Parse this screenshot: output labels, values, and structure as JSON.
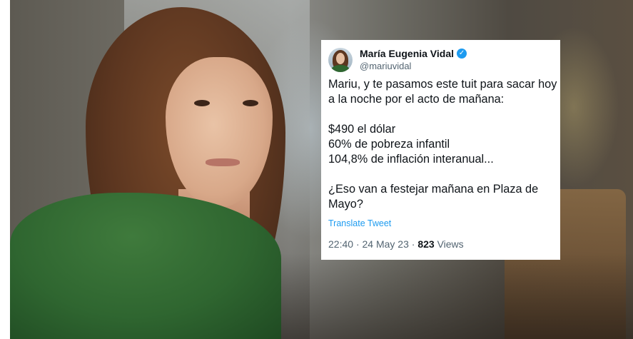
{
  "tweet": {
    "author_name": "María Eugenia Vidal",
    "author_handle": "@mariuvidal",
    "verified_icon": "verified-badge-icon",
    "body_lines_1": [
      "Mariu, y te pasamos este tuit para sacar hoy",
      "a la noche por el acto de mañana:"
    ],
    "body_lines_2": [
      "$490 el dólar",
      "60% de pobreza infantil",
      "104,8% de inflación interanual..."
    ],
    "body_lines_3": [
      "¿Eso van a festejar mañana en Plaza de",
      "Mayo?"
    ],
    "translate_label": "Translate Tweet",
    "time": "22:40",
    "separator": "·",
    "date": "24 May 23",
    "views_count": "823",
    "views_label": "Views"
  },
  "colors": {
    "link_blue": "#1d9bf0",
    "muted_text": "#536471",
    "shirt_green": "#2f6630"
  }
}
